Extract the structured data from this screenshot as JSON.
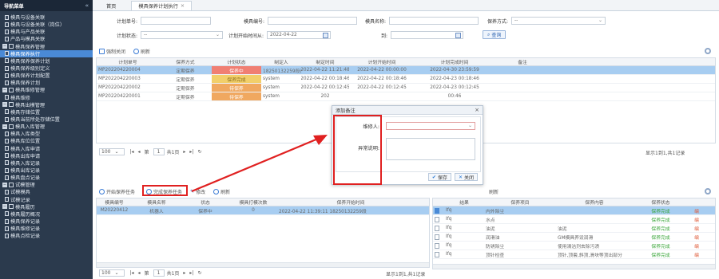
{
  "sidebar": {
    "title": "导航菜单",
    "collapse_glyph": "«",
    "items": [
      {
        "label": "模具与设备关联",
        "level": 1
      },
      {
        "label": "模具与设备关联（岗位）",
        "level": 1
      },
      {
        "label": "模具与产品关联",
        "level": 1
      },
      {
        "label": "产品与模具关联",
        "level": 1
      },
      {
        "label": "模具保养管理",
        "level": 0
      },
      {
        "label": "模具保养执行",
        "level": 1,
        "selected": true
      },
      {
        "label": "模具保养保养计划",
        "level": 1
      },
      {
        "label": "模具保养级别定义",
        "level": 1
      },
      {
        "label": "模具保养计划配置",
        "level": 1
      },
      {
        "label": "模具保养计划",
        "level": 1
      },
      {
        "label": "模具维修管理",
        "level": 0
      },
      {
        "label": "模具维修",
        "level": 1
      },
      {
        "label": "模具出模管理",
        "level": 0
      },
      {
        "label": "模具存储位置",
        "level": 1
      },
      {
        "label": "模具当前所处存储位置",
        "level": 1
      },
      {
        "label": "模具入库管理",
        "level": 0
      },
      {
        "label": "模具入库类型",
        "level": 1
      },
      {
        "label": "模具库位位置",
        "level": 1
      },
      {
        "label": "模具入库申请",
        "level": 1
      },
      {
        "label": "模具出库申请",
        "level": 1
      },
      {
        "label": "模具入库记录",
        "level": 1
      },
      {
        "label": "模具出库记录",
        "level": 1
      },
      {
        "label": "模具盘点记录",
        "level": 1
      },
      {
        "label": "试模管理",
        "level": 0
      },
      {
        "label": "试模模具",
        "level": 1
      },
      {
        "label": "试模记录",
        "level": 1
      },
      {
        "label": "模具履历",
        "level": 0
      },
      {
        "label": "模具履历概况",
        "level": 1
      },
      {
        "label": "模具保养记录",
        "level": 1
      },
      {
        "label": "模具维修记录",
        "level": 1
      },
      {
        "label": "模具点检记录",
        "level": 1
      }
    ]
  },
  "tabs": [
    {
      "label": "首页"
    },
    {
      "label": "模具保养计划执行",
      "close": "×",
      "active": true
    }
  ],
  "filters": {
    "plan_no_label": "计划单号:",
    "mold_no_label": "模具编号:",
    "mold_name_label": "模具名称:",
    "method_label": "保养方式:",
    "method_value": "--",
    "status_label": "计划状态:",
    "status_value": "--",
    "start_time_label": "计划开始时间从:",
    "start_time_value": "2022-04-22",
    "to_label": "到:",
    "query_label": "查询"
  },
  "top_toolbar": {
    "close_label": "强制关闭",
    "refresh_label": "刷新"
  },
  "plan_grid": {
    "columns": [
      "计划单号",
      "保养方式",
      "计划状态",
      "制定人",
      "制定时间",
      "计划开始时间",
      "计划完成时间",
      "备注"
    ],
    "rows": [
      {
        "no": "MP202204220004",
        "method": "定期保养",
        "status": "保养中",
        "status_color": "red",
        "maker": "18250132259段善君",
        "made": "2022-04-22 11:21:48",
        "start": "2022-04-22 00:00:00",
        "end": "2022-04-30 23:59:59",
        "note": "",
        "selected": true
      },
      {
        "no": "MP202204220003",
        "method": "定期保养",
        "status": "保养完成",
        "status_color": "yel",
        "maker": "system",
        "made": "2022-04-22 00:18:46",
        "start": "2022-04-22 00:18:46",
        "end": "2022-04-23 00:18:46",
        "note": ""
      },
      {
        "no": "MP202204220002",
        "method": "定期保养",
        "status": "待保养",
        "status_color": "ora",
        "maker": "system",
        "made": "2022-04-22 00:12:45",
        "start": "2022-04-22 00:12:45",
        "end": "2022-04-23 00:12:45",
        "note": ""
      },
      {
        "no": "MP202204220001",
        "method": "定期保养",
        "status": "待保养",
        "status_color": "ora",
        "maker": "system",
        "made": "202",
        "start": "",
        "end": "00:46",
        "note": ""
      }
    ],
    "pager": {
      "size": "100",
      "page_prefix": "第",
      "page": "1",
      "page_suffix": "共1页",
      "info": "显示1到1,共1记录"
    }
  },
  "bottom_toolbar": {
    "start_label": "开始保养任务",
    "finish_label": "完成保养任务",
    "edit_label": "修改",
    "refresh_label": "刷新",
    "right_refresh_label": "刷新"
  },
  "mold_grid": {
    "columns": [
      "模具编号",
      "模具名称",
      "状态",
      "模具打模次数",
      "保养开始时间"
    ],
    "rows": [
      {
        "no": "M20220412",
        "name": "机器人",
        "status": "保养中",
        "count": "0",
        "start": "2022-04-22 11:39:11 18250132259段"
      }
    ],
    "pager": {
      "size": "100",
      "page_prefix": "第",
      "page": "1",
      "page_suffix": "共1页",
      "info": "显示1到1,共1记录"
    }
  },
  "item_grid": {
    "columns": [
      "",
      "结果",
      "保养项目",
      "保养内容",
      "保养状态",
      ""
    ],
    "rows": [
      {
        "checked": true,
        "result": "Ifq",
        "item": "内外除尘",
        "content": "",
        "state": "保养完成",
        "op": "编"
      },
      {
        "checked": false,
        "result": "Ifq",
        "item": "水点",
        "content": "",
        "state": "保养完成",
        "op": "编"
      },
      {
        "checked": false,
        "result": "Ifq",
        "item": "油泥",
        "content": "油泥",
        "state": "保养完成",
        "op": "编"
      },
      {
        "checked": false,
        "result": "Ifq",
        "item": "润滑油",
        "content": "GM模具养设润滑",
        "state": "保养完成",
        "op": "编"
      },
      {
        "checked": false,
        "result": "Ifq",
        "item": "防锈除尘",
        "content": "使用清洁剂去除污渍",
        "state": "保养完成",
        "op": "编"
      },
      {
        "checked": false,
        "result": "Ifq",
        "item": "顶针检查",
        "content": "顶针,顶套,斜顶,滑块等顶出部分",
        "state": "保养完成",
        "op": "编"
      }
    ]
  },
  "dialog": {
    "title": "添加备注",
    "close": "×",
    "handler_label": "维修人:",
    "handler_value": "",
    "remark_label": "异常说明:",
    "save_label": "保存",
    "close_label": "关闭"
  },
  "colors": {
    "sidebar": "#2b3a4d",
    "selected": "#4a8ad6",
    "highlight": "#e02020"
  }
}
